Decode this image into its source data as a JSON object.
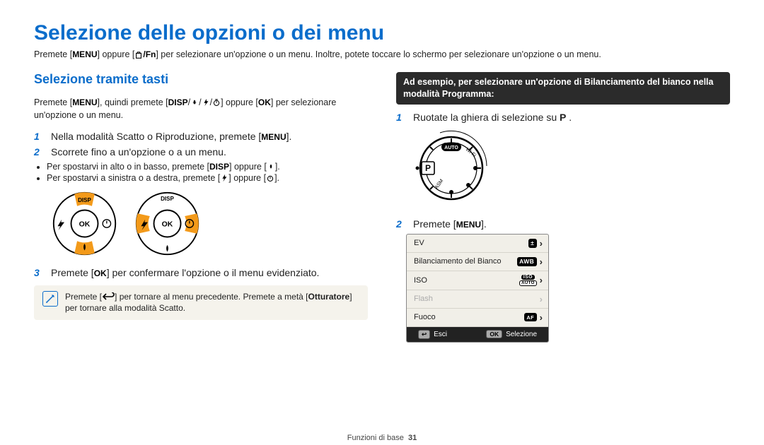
{
  "page": {
    "title": "Selezione delle opzioni o dei menu",
    "intro_a": "Premete [",
    "intro_menu": "MENU",
    "intro_b": "] oppure [",
    "intro_trashfn": "/Fn",
    "intro_c": "] per selezionare un'opzione o un menu. Inoltre, potete toccare lo schermo per selezionare un'opzione o un menu.",
    "footer_label": "Funzioni di base",
    "footer_page": "31"
  },
  "left": {
    "subtitle": "Selezione tramite tasti",
    "lead_a": "Premete [",
    "lead_menu": "MENU",
    "lead_b": "], quindi premete [",
    "lead_disp": "DISP",
    "lead_c": "] oppure [",
    "lead_ok": "OK",
    "lead_d": "] per selezionare un'opzione o un menu.",
    "step1_a": "Nella modalità Scatto o Riproduzione, premete [",
    "step1_menu": "MENU",
    "step1_b": "].",
    "step2": "Scorrete fino a un'opzione o a un menu.",
    "bullet1_a": "Per spostarvi in alto o in basso, premete [",
    "bullet1_disp": "DISP",
    "bullet1_b": "] oppure [",
    "bullet1_c": "].",
    "bullet2_a": "Per spostarvi a sinistra o a destra, premete [",
    "bullet2_b": "] oppure [",
    "bullet2_c": "].",
    "dial_label_disp": "DISP",
    "dial_label_ok": "OK",
    "step3_a": "Premete [",
    "step3_ok": "OK",
    "step3_b": "] per confermare l'opzione o il menu evidenziato.",
    "note_a": "Premete [",
    "note_b": "] per tornare al menu precedente. Premete a metà [",
    "note_bold": "Otturatore",
    "note_c": "] per tornare alla modalità Scatto."
  },
  "right": {
    "callout": "Ad esempio, per selezionare un'opzione di Bilanciamento del bianco nella modalità Programma:",
    "step1_a": "Ruotate la ghiera di selezione su ",
    "step1_mode": "P",
    "step1_b": "·",
    "step2_a": "Premete [",
    "step2_menu": "MENU",
    "step2_b": "].",
    "menu": {
      "rows": [
        {
          "label": "EV",
          "badge": "±",
          "chev": true,
          "disabled": false
        },
        {
          "label": "Bilanciamento del Bianco",
          "badge": "AWB",
          "chev": true,
          "disabled": false
        },
        {
          "label": "ISO",
          "badge": "ISO",
          "badge2": "AUTO",
          "chev": true,
          "disabled": false
        },
        {
          "label": "Flash",
          "badge": "",
          "chev": true,
          "disabled": true
        },
        {
          "label": "Fuoco",
          "badge": "AF",
          "chev": true,
          "disabled": false
        }
      ],
      "footer_esc": "Esci",
      "footer_esc_key": "↩",
      "footer_sel": "Selezione",
      "footer_sel_key": "OK"
    }
  }
}
